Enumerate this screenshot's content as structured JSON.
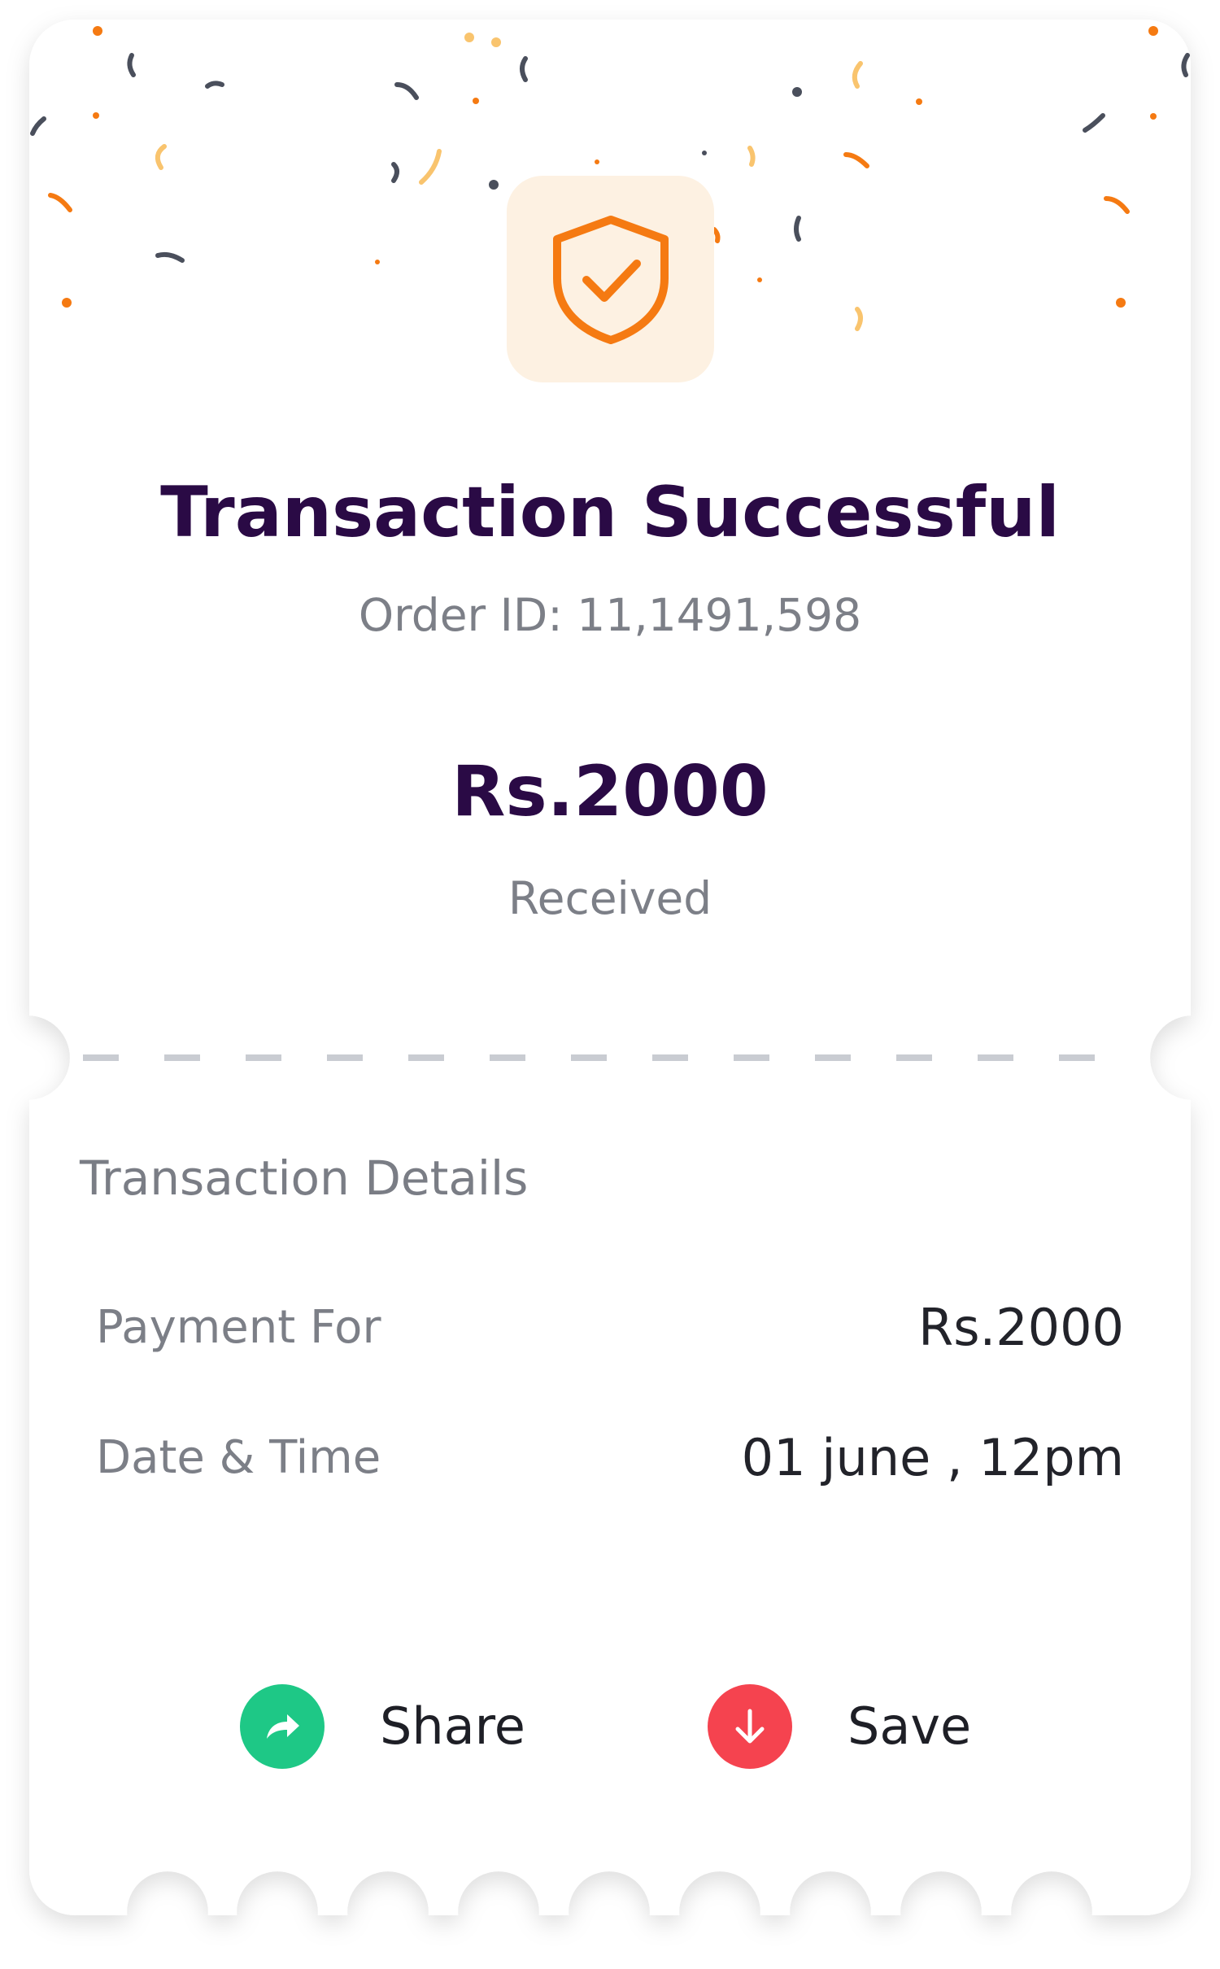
{
  "status": {
    "title": "Transaction Successful",
    "order_id": "Order ID: 11,1491,598",
    "icon": "shield-check-icon"
  },
  "amount": {
    "value": "Rs.2000",
    "status": "Received"
  },
  "details": {
    "heading": "Transaction Details",
    "rows": [
      {
        "label": "Payment For",
        "value": "Rs.2000"
      },
      {
        "label": "Date & Time",
        "value": "01 june , 12pm"
      }
    ]
  },
  "actions": {
    "share_label": "Share",
    "share_icon": "share-arrow-icon",
    "save_label": "Save",
    "save_icon": "download-arrow-icon"
  },
  "colors": {
    "title": "#2a0a45",
    "accent_orange": "#f57a12",
    "icon_bg": "#fdf1e2",
    "share": "#1ec886",
    "save": "#f5434f",
    "muted_text": "#7c7f87"
  }
}
